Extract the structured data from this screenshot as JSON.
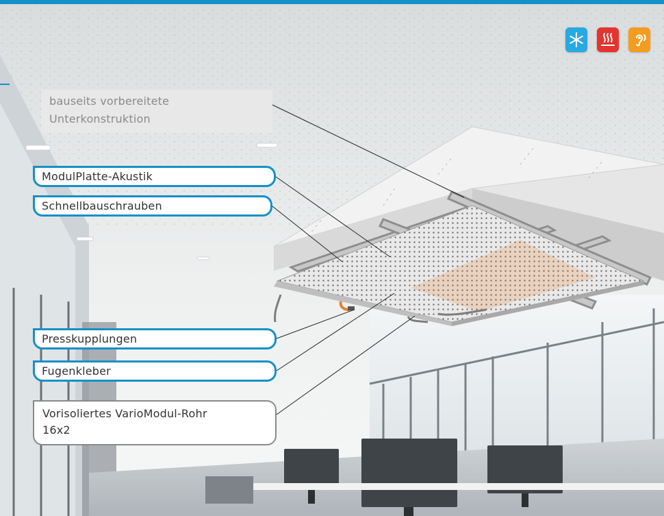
{
  "labels": {
    "unterkonstruktion": "bauseits vorbereitete Unterkonstruktion",
    "modulplatte": "ModulPlatte-Akustik",
    "schrauben": "Schnellbauschrauben",
    "presskupplungen": "Presskupplungen",
    "fugenkleber": "Fugenkleber",
    "rohr_line1": "Vorisoliertes VarioModul-Rohr",
    "rohr_line2": "16x2"
  },
  "icons": [
    {
      "name": "cooling-icon",
      "color": "#27a9e1"
    },
    {
      "name": "heating-icon",
      "color": "#e3342f"
    },
    {
      "name": "acoustic-icon",
      "color": "#f39c1f"
    }
  ],
  "colors": {
    "accent": "#1590c8",
    "callout_gray": "#8a8a8a",
    "pipe": "#e8812a"
  }
}
